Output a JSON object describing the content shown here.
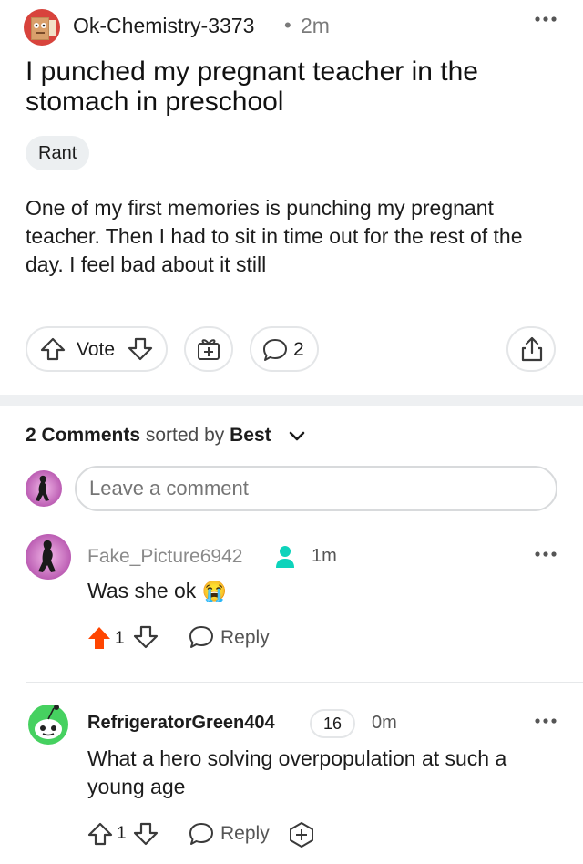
{
  "post": {
    "username": "Ok-Chemistry-3373",
    "separator": "•",
    "time": "2m",
    "title": "I punched my pregnant teacher in the stomach in preschool",
    "flair": "Rant",
    "body": "One of my first memories is punching my pregnant teacher. Then I had to sit in time out for the rest of the day. I feel bad about it still",
    "vote_label": "Vote",
    "comment_count": "2",
    "icons": [
      "more-icon",
      "upvote-icon",
      "downvote-icon",
      "award-icon",
      "comment-icon",
      "share-icon"
    ]
  },
  "comments_header": {
    "count_label": "2 Comments",
    "sorted_by": "sorted by",
    "sort_value": "Best",
    "icons": [
      "chevron-down-icon"
    ]
  },
  "composer": {
    "placeholder": "Leave a comment"
  },
  "comments": [
    {
      "username": "Fake_Picture6942",
      "time": "1m",
      "text": "Was she ok",
      "emoji": "😭",
      "votes": "1",
      "upvoted": true,
      "reply_label": "Reply"
    },
    {
      "username": "RefrigeratorGreen404",
      "karma": "16",
      "time": "0m",
      "text": "What a hero solving overpopulation at such a young age",
      "votes": "1",
      "upvoted": false,
      "reply_label": "Reply"
    }
  ],
  "colors": {
    "upvote_active": "#ff4500",
    "online_indicator": "#0dd3bb",
    "snoo_green": "#46d160"
  }
}
